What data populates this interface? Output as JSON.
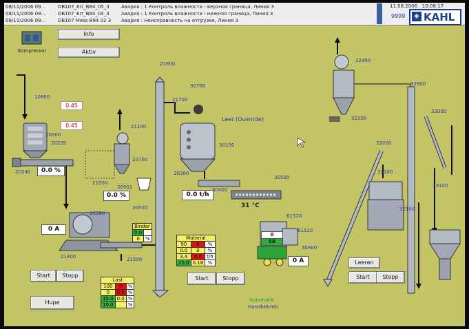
{
  "alarms": [
    {
      "time": "08/11/2006 09...",
      "tag": "DB107_Err_B84_05_3",
      "text": "Авария : 1 Контроль влажности - верхняя граница, Линия 3"
    },
    {
      "time": "08/11/2006 09...",
      "tag": "DB107_Err_B84_04_3",
      "text": "Авария : 1 Контроль влажности - нижняя граница, Линия 3"
    },
    {
      "time": "08/11/2006 09...",
      "tag": "DB107 Mess B94 02 3",
      "text": "Авария : Неисправность на отгрузке, Линия 3"
    }
  ],
  "header": {
    "date": "11.08.2006",
    "time": "10:08:17",
    "code": "9999",
    "logo": "KAHL"
  },
  "buttons": {
    "info": "Info",
    "aktiv": "Aktiv",
    "hupe": "Hupe",
    "start": "Start",
    "stopp": "Stopp",
    "leeren": "Leeren"
  },
  "labels": {
    "kompressor": "Kompressor",
    "leer_override": "Leer (Override)",
    "binder": "Binder",
    "material": "Material",
    "last": "Last",
    "automatik": "Automatik",
    "handbetrieb": "Handbetrieb",
    "temp": "31 °C"
  },
  "tags": {
    "t10600": "10600",
    "t20200": "20200",
    "t20220": "20220",
    "t20240": "20240",
    "t21000": "21000",
    "t21100": "21100",
    "t20700": "20700",
    "t30901": "30901",
    "t20300": "20300",
    "t21400": "21400",
    "t21500": "21500",
    "t30500a": "30500",
    "t21600": "21600",
    "t30700": "30700",
    "t21700": "21700",
    "t30100": "30100",
    "t30300": "30300",
    "t30400": "30400",
    "t30500b": "30500",
    "t61520a": "61520",
    "t61520b": "61520",
    "t30800": "30800",
    "t32400": "32400",
    "t32300": "32300",
    "t32000": "32000",
    "t32100a": "32100",
    "t32100b": "32100",
    "t32900": "32900",
    "t33000": "33000",
    "t33100": "33100"
  },
  "values": {
    "pct_left": "0.0 %",
    "pct_mid": "0.0 %",
    "amps_left": "0 A",
    "amps_right": "0 A",
    "flow": "0.0 t/h",
    "red1": "0.45",
    "red2": "0.45",
    "cond1": "0",
    "cond2": "50"
  },
  "binder_table": [
    [
      "0.0",
      ""
    ],
    [
      "0",
      "%"
    ]
  ],
  "material_table": [
    [
      "90",
      "0",
      "%"
    ],
    [
      "0.0",
      "0",
      "%"
    ],
    [
      "3.4",
      "0.0",
      "t/h"
    ],
    [
      "15.0",
      "0.18",
      "%"
    ]
  ],
  "last_table": [
    [
      "100",
      "0",
      "%"
    ],
    [
      "0",
      "0.0",
      "%"
    ],
    [
      "15.0",
      "0.0",
      "%"
    ],
    [
      "10.0",
      "",
      "%"
    ]
  ]
}
